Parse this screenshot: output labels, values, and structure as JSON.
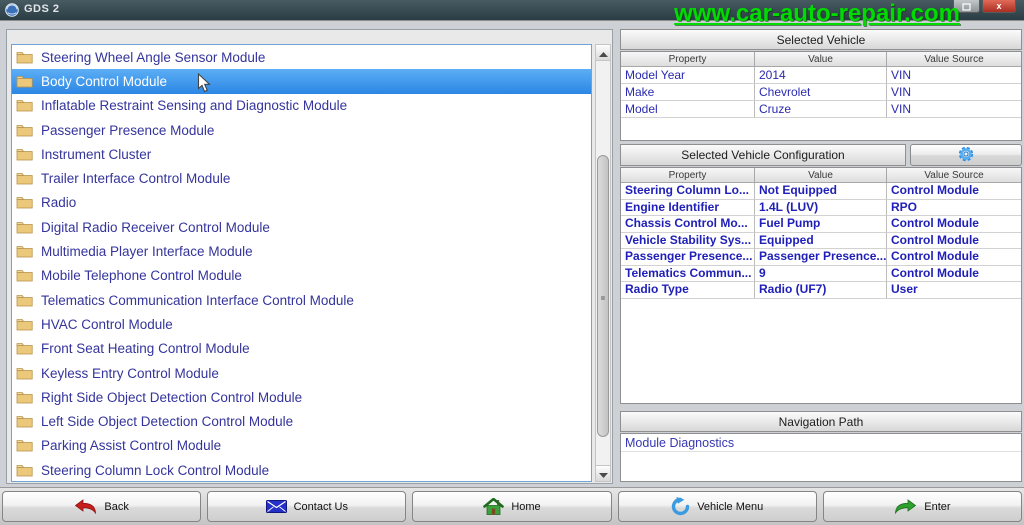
{
  "window": {
    "title": "GDS 2",
    "watermark": "www.car-auto-repair.com"
  },
  "module_list": {
    "selected_index": 1,
    "items": [
      "Steering Wheel Angle Sensor Module",
      "Body Control Module",
      "Inflatable Restraint Sensing and Diagnostic Module",
      "Passenger Presence Module",
      "Instrument Cluster",
      "Trailer Interface Control Module",
      "Radio",
      "Digital Radio Receiver Control Module",
      "Multimedia Player Interface Module",
      "Mobile Telephone Control Module",
      "Telematics Communication Interface Control Module",
      "HVAC Control Module",
      "Front Seat Heating Control Module",
      "Keyless Entry Control Module",
      "Right Side Object Detection Control Module",
      "Left Side Object Detection Control Module",
      "Parking Assist Control Module",
      "Steering Column Lock Control Module"
    ]
  },
  "selected_vehicle": {
    "title": "Selected Vehicle",
    "columns": [
      "Property",
      "Value",
      "Value Source"
    ],
    "rows": [
      [
        "Model Year",
        "2014",
        "VIN"
      ],
      [
        "Make",
        "Chevrolet",
        "VIN"
      ],
      [
        "Model",
        "Cruze",
        "VIN"
      ]
    ]
  },
  "vehicle_configuration": {
    "title": "Selected Vehicle Configuration",
    "refresh_icon": "gear-icon",
    "columns": [
      "Property",
      "Value",
      "Value Source"
    ],
    "rows": [
      [
        "Steering Column Lo...",
        "Not Equipped",
        "Control Module"
      ],
      [
        "Engine Identifier",
        "1.4L (LUV)",
        "RPO"
      ],
      [
        "Chassis Control Mo...",
        "Fuel Pump",
        "Control Module"
      ],
      [
        "Vehicle Stability Sys...",
        "Equipped",
        "Control Module"
      ],
      [
        "Passenger Presence...",
        "Passenger Presence...",
        "Control Module"
      ],
      [
        "Telematics Commun...",
        "9",
        "Control Module"
      ],
      [
        "Radio Type",
        "Radio (UF7)",
        "User"
      ]
    ]
  },
  "navigation_path": {
    "title": "Navigation Path",
    "items": [
      "Module Diagnostics"
    ]
  },
  "toolbar": {
    "buttons": [
      {
        "label": "Back",
        "icon": "back-arrow-icon"
      },
      {
        "label": "Contact Us",
        "icon": "mail-icon"
      },
      {
        "label": "Home",
        "icon": "home-icon"
      },
      {
        "label": "Vehicle Menu",
        "icon": "vehicle-menu-icon"
      },
      {
        "label": "Enter",
        "icon": "enter-arrow-icon"
      }
    ]
  },
  "colors": {
    "selection_blue": "#2b86e4",
    "list_text_blue": "#34349c",
    "table_text_blue": "#2020b8",
    "watermark_green": "#00dc00",
    "accent_blue": "#2e8fe0",
    "titlebar_teal": "#2a3c44"
  }
}
